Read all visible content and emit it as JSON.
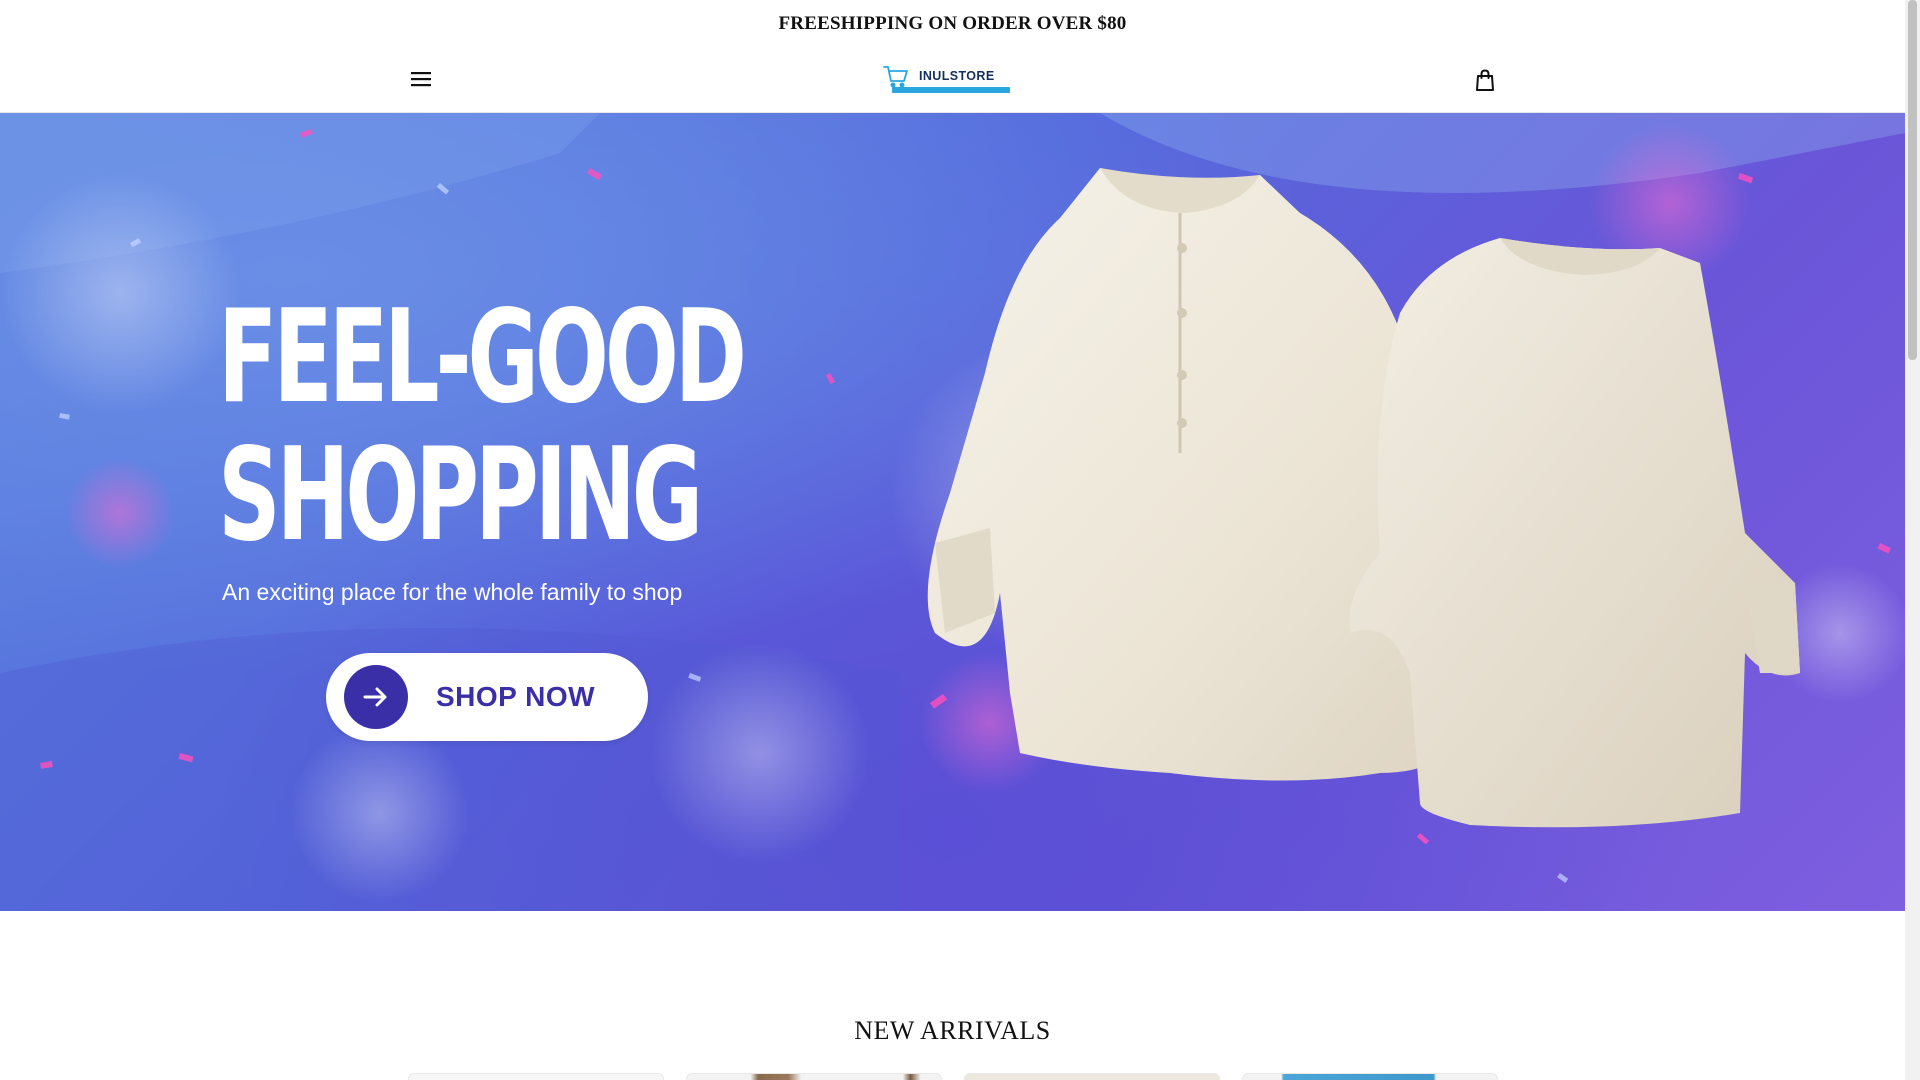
{
  "announcement": {
    "text": "FREESHIPPING ON ORDER OVER $80"
  },
  "header": {
    "menu_icon": "hamburger-menu-icon",
    "logo_text": "INULSTORE",
    "logo_icon": "shopping-cart-icon",
    "cart_icon": "shopping-bag-icon"
  },
  "hero": {
    "title_line1": "FEEL-GOOD",
    "title_line2": "SHOPPING",
    "subtitle": "An exciting place for the whole family to shop",
    "cta_label": "SHOP NOW",
    "cta_icon": "arrow-right-icon"
  },
  "new_arrivals": {
    "title": "NEW ARRIVALS"
  },
  "colors": {
    "brand_blue": "#3b2fa8",
    "logo_accent": "#2aa6de",
    "shirt": "#efe9dc"
  }
}
